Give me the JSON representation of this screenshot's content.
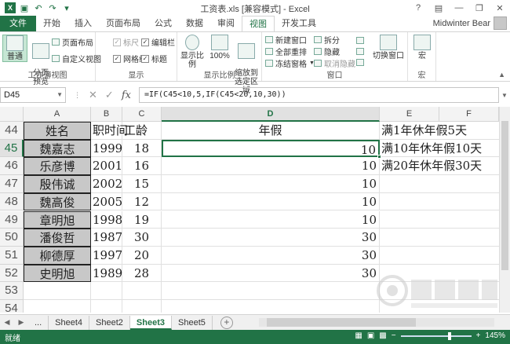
{
  "app": {
    "title": "工资表.xls  [兼容模式] - Excel",
    "file_tab": "文件",
    "tabs": [
      "开始",
      "插入",
      "页面布局",
      "公式",
      "数据",
      "审阅",
      "视图",
      "开发工具"
    ],
    "active_tab": "视图",
    "user": "Midwinter Bear",
    "accent": "#217346"
  },
  "ribbon": {
    "views": {
      "normal": "普通",
      "page_break": "分页\n预览",
      "page_layout": "页面布局",
      "custom": "自定义视图",
      "group": "工作簿视图"
    },
    "show": {
      "ruler": "标尺",
      "formula_bar": "编辑栏",
      "gridlines": "网格线",
      "headings": "标题",
      "group": "显示"
    },
    "zoom": {
      "zoom": "显示比例",
      "hundred": "100%",
      "to_selection": "缩放到\n选定区域",
      "group": "显示比例"
    },
    "window": {
      "new_window": "新建窗口",
      "arrange_all": "全部重排",
      "freeze": "冻结窗格",
      "split": "拆分",
      "hide": "隐藏",
      "unhide": "取消隐藏",
      "switch": "切换窗口",
      "group": "窗口"
    },
    "macros": {
      "macro": "宏",
      "group": "宏"
    }
  },
  "formula_bar": {
    "name_box": "D45",
    "formula": "=IF(C45<10,5,IF(C45<20,10,30))"
  },
  "columns": [
    "A",
    "B",
    "C",
    "D",
    "E",
    "F"
  ],
  "rows": [
    {
      "num": "44",
      "a": "姓名",
      "b": "职时间",
      "c": "工龄",
      "d": "年假",
      "e": "满1年休年假5天"
    },
    {
      "num": "45",
      "a": "魏嘉志",
      "b": "1999",
      "c": "18",
      "d": "10",
      "e": "满10年休年假10天"
    },
    {
      "num": "46",
      "a": "乐彦博",
      "b": "2001",
      "c": "16",
      "d": "10",
      "e": "满20年休年假30天"
    },
    {
      "num": "47",
      "a": "殷伟诚",
      "b": "2002",
      "c": "15",
      "d": "10",
      "e": ""
    },
    {
      "num": "48",
      "a": "魏高俊",
      "b": "2005",
      "c": "12",
      "d": "10",
      "e": ""
    },
    {
      "num": "49",
      "a": "章明旭",
      "b": "1998",
      "c": "19",
      "d": "10",
      "e": ""
    },
    {
      "num": "50",
      "a": "潘俊哲",
      "b": "1987",
      "c": "30",
      "d": "30",
      "e": ""
    },
    {
      "num": "51",
      "a": "柳德厚",
      "b": "1997",
      "c": "20",
      "d": "30",
      "e": ""
    },
    {
      "num": "52",
      "a": "史明旭",
      "b": "1989",
      "c": "28",
      "d": "30",
      "e": ""
    },
    {
      "num": "53",
      "a": "",
      "b": "",
      "c": "",
      "d": "",
      "e": ""
    },
    {
      "num": "54",
      "a": "",
      "b": "",
      "c": "",
      "d": "",
      "e": ""
    }
  ],
  "sheets": {
    "ellipsis": "...",
    "tabs": [
      "Sheet4",
      "Sheet2",
      "Sheet3",
      "Sheet5"
    ],
    "active": "Sheet3"
  },
  "status": {
    "ready": "就绪",
    "zoom": "145%"
  }
}
